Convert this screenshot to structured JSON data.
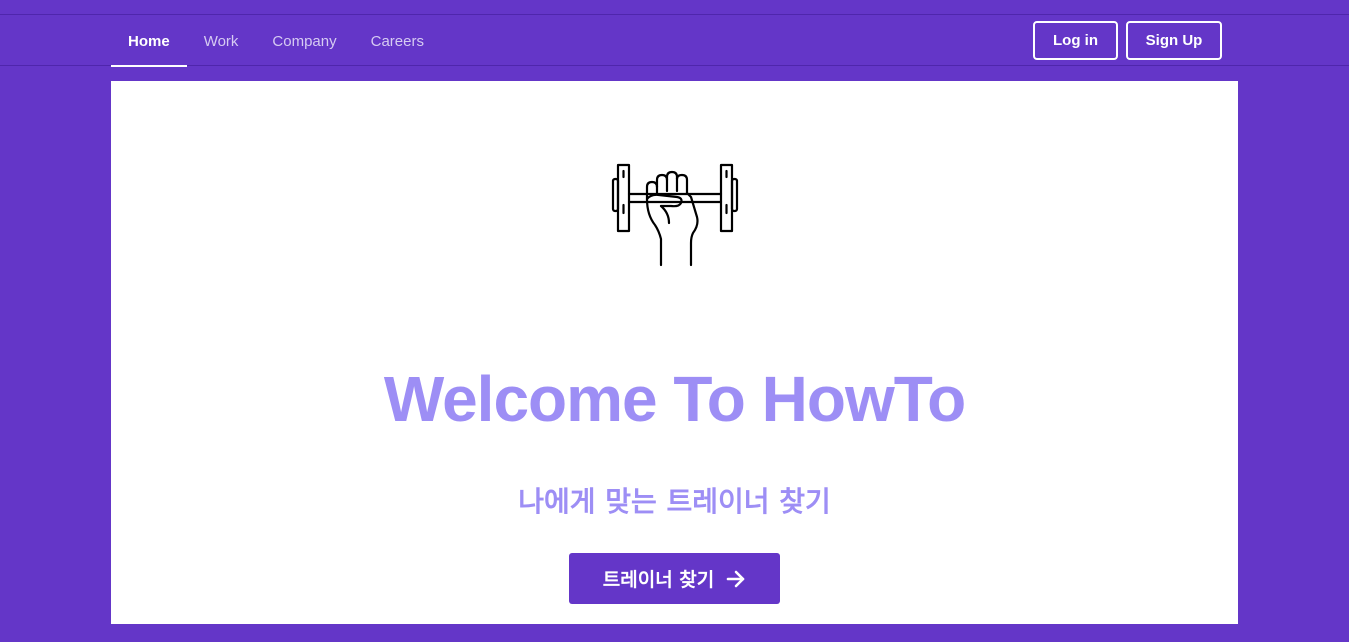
{
  "nav": {
    "links": [
      {
        "label": "Home",
        "active": true
      },
      {
        "label": "Work"
      },
      {
        "label": "Company"
      },
      {
        "label": "Careers"
      }
    ],
    "login_label": "Log in",
    "signup_label": "Sign Up"
  },
  "hero": {
    "icon": "dumbbell-fist-icon",
    "title": "Welcome To HowTo",
    "subtitle": "나에게 맞는 트레이너 찾기",
    "cta_label": "트레이너 찾기",
    "cta_icon": "arrow-right-icon"
  },
  "colors": {
    "brand": "#6436c8",
    "accent_text": "#9d8ef5",
    "surface": "#ffffff"
  }
}
